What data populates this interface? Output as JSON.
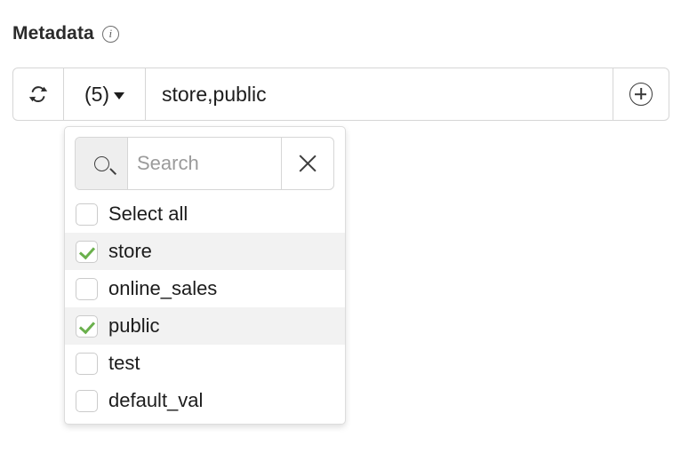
{
  "header": {
    "title": "Metadata",
    "info_icon_glyph": "i",
    "info_icon_name": "info-icon"
  },
  "input_bar": {
    "refresh_icon": "refresh-icon",
    "count_label": "(5)",
    "caret_icon": "chevron-down-icon",
    "value": "store,public",
    "add_icon": "plus-circle-icon"
  },
  "dropdown": {
    "search": {
      "search_icon": "search-icon",
      "placeholder": "Search",
      "value": "",
      "clear_icon": "close-icon"
    },
    "options": [
      {
        "label": "Select all",
        "checked": false
      },
      {
        "label": "store",
        "checked": true
      },
      {
        "label": "online_sales",
        "checked": false
      },
      {
        "label": "public",
        "checked": true
      },
      {
        "label": "test",
        "checked": false
      },
      {
        "label": "default_val",
        "checked": false
      }
    ]
  },
  "colors": {
    "check_green": "#6ab04c",
    "border_gray": "#d6d6d6",
    "selected_row": "#f2f2f2",
    "search_btn_bg": "#eeeeee",
    "text": "#1c1c1c",
    "placeholder": "#9b9b9b"
  }
}
